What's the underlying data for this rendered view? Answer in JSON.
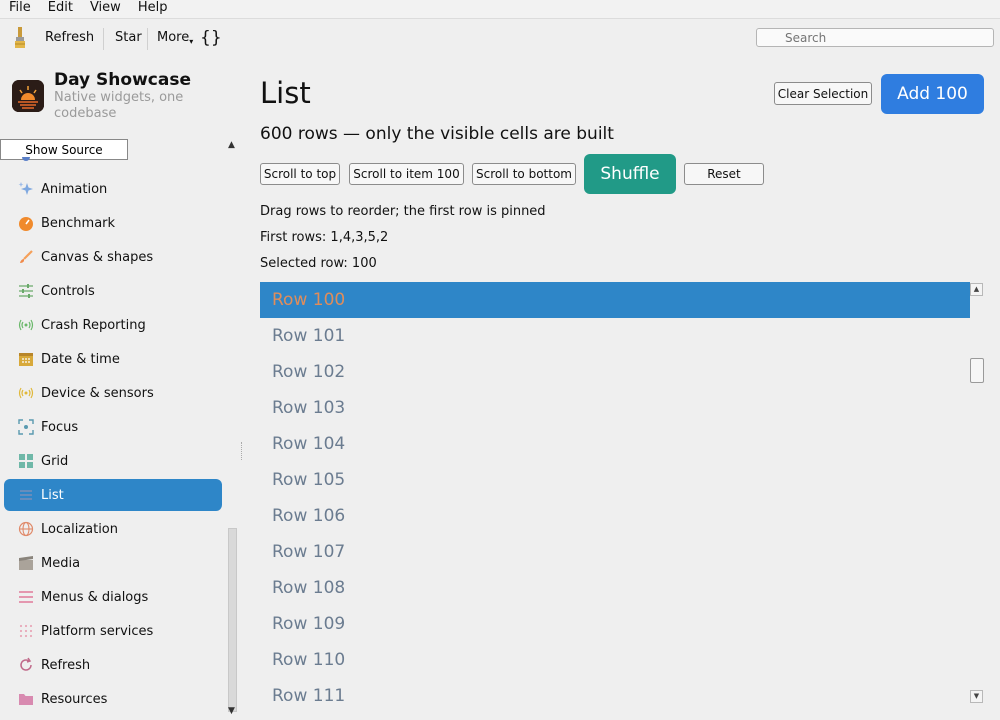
{
  "menubar": [
    "File",
    "Edit",
    "View",
    "Help"
  ],
  "toolbar": {
    "refresh": "Refresh",
    "star": "Star",
    "more": "More",
    "source_glyph": "{}",
    "search_placeholder": "Search"
  },
  "app": {
    "title": "Day Showcase",
    "subtitle": "Native widgets, one codebase",
    "show_source": "Show Source"
  },
  "sidebar": {
    "items": [
      {
        "label": "Animation",
        "icon": "sparkle-icon"
      },
      {
        "label": "Benchmark",
        "icon": "gauge-icon"
      },
      {
        "label": "Canvas & shapes",
        "icon": "brush-icon"
      },
      {
        "label": "Controls",
        "icon": "sliders-icon"
      },
      {
        "label": "Crash Reporting",
        "icon": "broadcast-icon"
      },
      {
        "label": "Date & time",
        "icon": "calendar-icon"
      },
      {
        "label": "Device & sensors",
        "icon": "sensor-icon"
      },
      {
        "label": "Focus",
        "icon": "focus-icon"
      },
      {
        "label": "Grid",
        "icon": "grid-icon"
      },
      {
        "label": "List",
        "icon": "list-icon"
      },
      {
        "label": "Localization",
        "icon": "globe-icon"
      },
      {
        "label": "Media",
        "icon": "film-icon"
      },
      {
        "label": "Menus & dialogs",
        "icon": "menu-icon"
      },
      {
        "label": "Platform services",
        "icon": "dots-grid-icon"
      },
      {
        "label": "Refresh",
        "icon": "refresh-icon"
      },
      {
        "label": "Resources",
        "icon": "folder-icon"
      }
    ],
    "active": "List"
  },
  "page": {
    "title": "List",
    "clear_selection": "Clear Selection",
    "add": "Add 100",
    "subtitle": "600 rows — only the visible cells are built",
    "scroll_top": "Scroll to top",
    "scroll_item": "Scroll to item 100",
    "scroll_bottom": "Scroll to bottom",
    "shuffle": "Shuffle",
    "reset": "Reset",
    "drag_hint": "Drag rows to reorder; the first row is pinned",
    "first_rows": "First rows: 1,4,3,5,2",
    "selected_row": "Selected row: 100"
  },
  "list": {
    "rows": [
      "Row 100",
      "Row 101",
      "Row 102",
      "Row 103",
      "Row 104",
      "Row 105",
      "Row 106",
      "Row 107",
      "Row 108",
      "Row 109",
      "Row 110",
      "Row 111"
    ],
    "selected_index": 0
  },
  "colors": {
    "accent": "#2e86c8",
    "add_button": "#2f7de0",
    "shuffle_button": "#219a87",
    "row_text": "#6b7c90",
    "selected_row_text": "#e08d5b"
  }
}
